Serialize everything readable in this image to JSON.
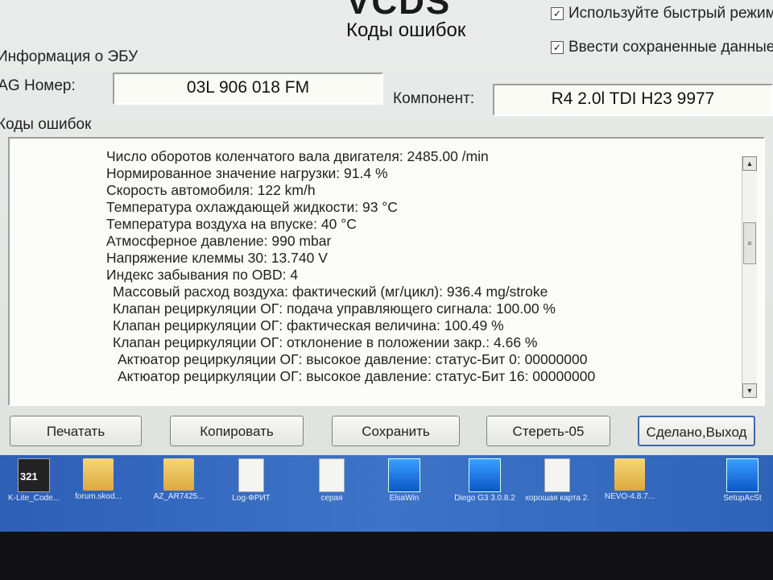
{
  "header": {
    "logo": "VCDS",
    "title": "Коды ошибок"
  },
  "options": {
    "fast_mode": {
      "label": "Используйте быстрый режим",
      "checked": true
    },
    "saved_data": {
      "label": "Ввести сохраненные данные",
      "checked": true
    }
  },
  "ecu_info": {
    "group_label": "Информация о ЭБУ",
    "vag_label": "VAG Номер:",
    "vag_value": "03L 906 018 FM",
    "component_label": "Компонент:",
    "component_value": "R4 2.0l TDI    H23 9977"
  },
  "fault_codes": {
    "group_label": "Коды ошибок",
    "lines": [
      "Число оборотов коленчатого вала двигателя: 2485.00 /min",
      "Нормированное значение нагрузки: 91.4 %",
      "Скорость автомобиля: 122 km/h",
      "Температура охлаждающей жидкости: 93 °C",
      "Температура воздуха на впуске: 40 °C",
      "Атмосферное давление: 990 mbar",
      "Напряжение клеммы 30: 13.740 V",
      "Индекс забывания по OBD: 4",
      "Массовый расход воздуха: фактический (мг/цикл): 936.4 mg/stroke",
      "Клапан рециркуляции ОГ: подача управляющего сигнала: 100.00 %",
      "Клапан рециркуляции ОГ: фактическая величина: 100.49 %",
      "Клапан рециркуляции ОГ: отклонение в положении закр.: 4.66 %",
      "Актюатор рециркуляции ОГ: высокое давление: статус-Бит 0: 00000000",
      "Актюатор рециркуляции ОГ: высокое давление: статус-Бит 16: 00000000"
    ]
  },
  "buttons": {
    "print": "Печатать",
    "copy": "Копировать",
    "save": "Сохранить",
    "clear": "Стереть-05",
    "done": "Сделано,Выход"
  },
  "desktop_icons": [
    {
      "label": "K-Lite_Code...",
      "kind": "media",
      "badge": "321"
    },
    {
      "label": "forum.skod...",
      "kind": "folder"
    },
    {
      "label": "AZ_AR7425...",
      "kind": "folder"
    },
    {
      "label": "Log-ФРИТ",
      "kind": "file"
    },
    {
      "label": "серая",
      "kind": "file"
    },
    {
      "label": "ElsaWin",
      "kind": "app"
    },
    {
      "label": "Diego G3 3.0.8.2",
      "kind": "app"
    },
    {
      "label": "хорошая карта 2...",
      "kind": "file"
    },
    {
      "label": "NEVO-4.8.7...",
      "kind": "folder"
    },
    {
      "label": "SetupAcSt",
      "kind": "app"
    }
  ],
  "colors": {
    "window_bg": "#e3e6e3",
    "desktop_blue": "#3d74c8",
    "default_button_border": "#3b6aa8"
  }
}
